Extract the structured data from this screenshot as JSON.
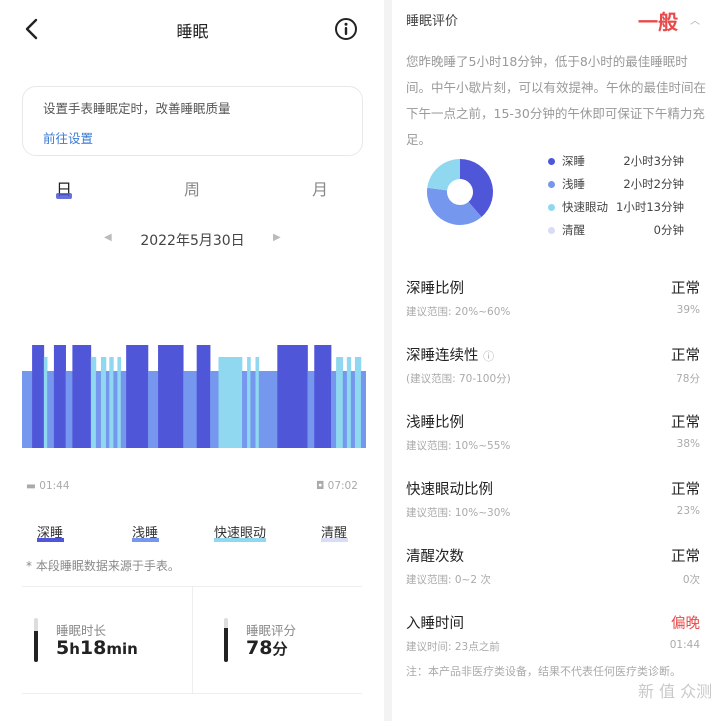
{
  "header": {
    "title": "睡眠",
    "back_icon": "chevron-left-icon",
    "info_icon": "info-circle-icon"
  },
  "tip": {
    "text": "设置手表睡眠定时，改善睡眠质量",
    "link": "前往设置"
  },
  "tabs": [
    {
      "label": "日",
      "active": true
    },
    {
      "label": "周",
      "active": false
    },
    {
      "label": "月",
      "active": false
    }
  ],
  "date": "2022年5月30日",
  "timeline": {
    "start": "01:44",
    "end": "07:02",
    "start_icon": "bed-icon",
    "end_icon": "wake-icon",
    "colors": {
      "deep": "#5056d8",
      "light": "#7597ee",
      "rem": "#8fd8ef"
    },
    "segments": [
      {
        "stage": "light",
        "dur": 3
      },
      {
        "stage": "deep",
        "dur": 3.5
      },
      {
        "stage": "rem",
        "dur": 1
      },
      {
        "stage": "light",
        "dur": 2
      },
      {
        "stage": "deep",
        "dur": 3.5
      },
      {
        "stage": "light",
        "dur": 2
      },
      {
        "stage": "deep",
        "dur": 5.5
      },
      {
        "stage": "rem",
        "dur": 1.5
      },
      {
        "stage": "light",
        "dur": 1.5
      },
      {
        "stage": "rem",
        "dur": 1.5
      },
      {
        "stage": "light",
        "dur": 1
      },
      {
        "stage": "rem",
        "dur": 1.2
      },
      {
        "stage": "light",
        "dur": 1.2
      },
      {
        "stage": "rem",
        "dur": 1
      },
      {
        "stage": "light",
        "dur": 1.6
      },
      {
        "stage": "deep",
        "dur": 6.5
      },
      {
        "stage": "light",
        "dur": 3
      },
      {
        "stage": "deep",
        "dur": 7.5
      },
      {
        "stage": "light",
        "dur": 4
      },
      {
        "stage": "deep",
        "dur": 4
      },
      {
        "stage": "light",
        "dur": 2.5
      },
      {
        "stage": "rem",
        "dur": 7
      },
      {
        "stage": "light",
        "dur": 1.5
      },
      {
        "stage": "rem",
        "dur": 1
      },
      {
        "stage": "light",
        "dur": 1.5
      },
      {
        "stage": "rem",
        "dur": 1
      },
      {
        "stage": "light",
        "dur": 5.5
      },
      {
        "stage": "deep",
        "dur": 9
      },
      {
        "stage": "light",
        "dur": 2
      },
      {
        "stage": "deep",
        "dur": 5
      },
      {
        "stage": "light",
        "dur": 1.5
      },
      {
        "stage": "rem",
        "dur": 2
      },
      {
        "stage": "light",
        "dur": 1.2
      },
      {
        "stage": "rem",
        "dur": 1.2
      },
      {
        "stage": "light",
        "dur": 1.2
      },
      {
        "stage": "rem",
        "dur": 1.8
      },
      {
        "stage": "light",
        "dur": 1.5
      }
    ]
  },
  "legend": [
    {
      "label": "深睡",
      "color": "#5056d8"
    },
    {
      "label": "浅睡",
      "color": "#7597ee"
    },
    {
      "label": "快速眼动",
      "color": "#8fd8ef"
    },
    {
      "label": "清醒",
      "color": "#d8dcf4"
    }
  ],
  "source_note": "* 本段睡眠数据来源于手表。",
  "stats": [
    {
      "label": "睡眠时长",
      "value_h": "5",
      "unit_h": "h",
      "value_m": "18",
      "unit_m": "min",
      "level": 0.7
    },
    {
      "label": "睡眠评分",
      "value": "78",
      "unit": "分",
      "level": 0.78
    }
  ],
  "evaluation": {
    "title": "睡眠评价",
    "grade": "一般",
    "summary": "您昨晚睡了5小时18分钟，低于8小时的最佳睡眠时间。中午小歇片刻，可以有效提神。午休的最佳时间在下午一点之前，15-30分钟的午休即可保证下午精力充足。",
    "breakdown": [
      {
        "label": "深睡",
        "value": "2小时3分钟",
        "minutes": 123,
        "color": "#5056d8"
      },
      {
        "label": "浅睡",
        "value": "2小时2分钟",
        "minutes": 122,
        "color": "#7597ee"
      },
      {
        "label": "快速眼动",
        "value": "1小时13分钟",
        "minutes": 73,
        "color": "#8fd8ef"
      },
      {
        "label": "清醒",
        "value": "0分钟",
        "minutes": 0,
        "color": "#d8dcf4"
      }
    ],
    "metrics": [
      {
        "name": "深睡比例",
        "range": "建议范围: 20%~60%",
        "status": "正常",
        "value": "39%",
        "warn": false,
        "info": false
      },
      {
        "name": "深睡连续性",
        "range": "(建议范围: 70-100分)",
        "status": "正常",
        "value": "78分",
        "warn": false,
        "info": true
      },
      {
        "name": "浅睡比例",
        "range": "建议范围: 10%~55%",
        "status": "正常",
        "value": "38%",
        "warn": false,
        "info": false
      },
      {
        "name": "快速眼动比例",
        "range": "建议范围: 10%~30%",
        "status": "正常",
        "value": "23%",
        "warn": false,
        "info": false
      },
      {
        "name": "清醒次数",
        "range": "建议范围: 0~2 次",
        "status": "正常",
        "value": "0次",
        "warn": false,
        "info": false
      },
      {
        "name": "入睡时间",
        "range": "建议时间: 23点之前",
        "status": "偏晚",
        "value": "01:44",
        "warn": true,
        "info": false
      }
    ],
    "footnote": "注：本产品非医疗类设备，结果不代表任何医疗类诊断。"
  },
  "watermark": "新 值 众测"
}
